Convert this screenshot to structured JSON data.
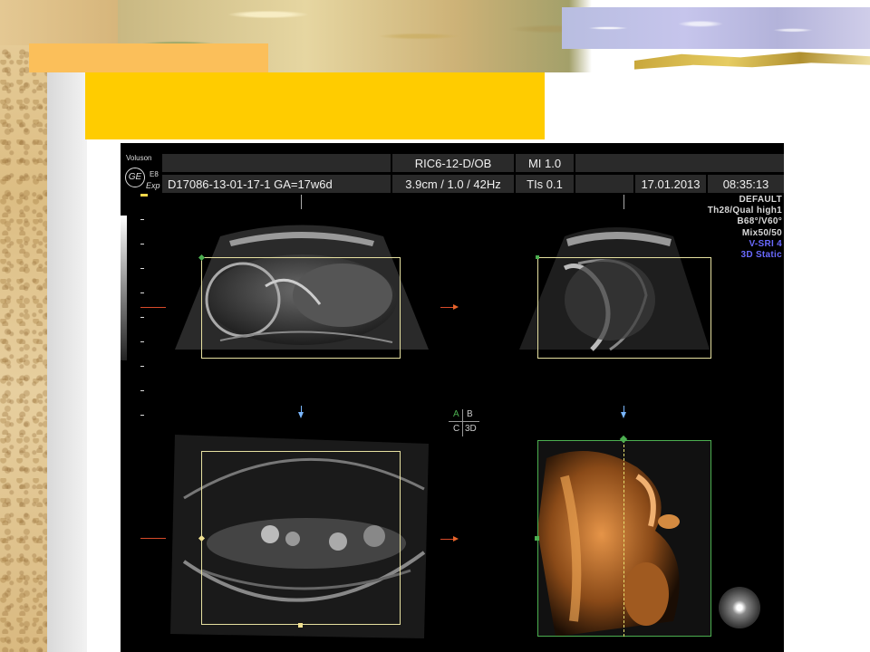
{
  "device": {
    "brand": "Voluson",
    "model": "E8",
    "edition": "Exp",
    "logo": "GE"
  },
  "header": {
    "probe": "RIC6-12-D/OB",
    "mi": "MI  1.0",
    "patient_id": "D17086-13-01-17-1  GA=17w6d",
    "depth_freq": "3.9cm / 1.0 / 42Hz",
    "tis": "TIs  0.1",
    "date": "17.01.2013",
    "time": "08:35:13"
  },
  "params": {
    "preset": "DEFAULT",
    "quality": "Th28/Qual high1",
    "angles": "B68°/V60°",
    "mix": "Mix50/50",
    "render_mode": "V-SRI 4",
    "mode": "3D Static"
  },
  "quadrant_labels": {
    "a": "A",
    "b": "B",
    "c": "C",
    "d": "3D"
  },
  "colors": {
    "roi_green": "#4caf50",
    "roi_yellow": "#e6e0a0",
    "render_orange": "#c8762a",
    "param_blue": "#6a6aff",
    "title_box": "#ffcc00",
    "accent_bar": "#fbbf5a"
  },
  "icons": {
    "logo": "ge-logo-icon",
    "view_orb": "view-orb-icon"
  }
}
